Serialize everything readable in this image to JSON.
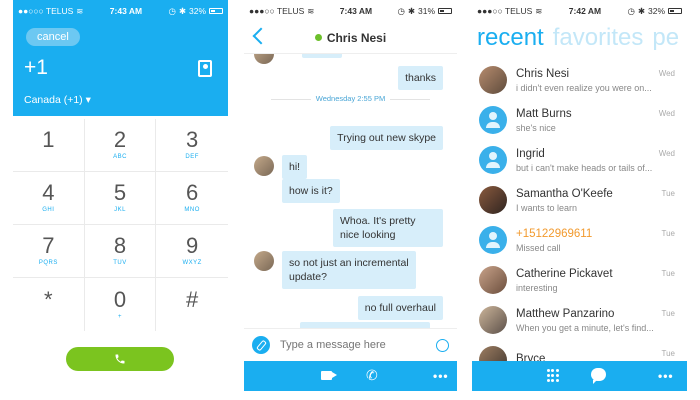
{
  "dialer": {
    "status": {
      "carrier": "●●○○○ TELUS",
      "time": "7:43 AM",
      "battery": "32%"
    },
    "cancel_label": "cancel",
    "number": "+1",
    "country": "Canada (+1) ▾",
    "keys": [
      {
        "digit": "1",
        "letters": ""
      },
      {
        "digit": "2",
        "letters": "ABC"
      },
      {
        "digit": "3",
        "letters": "DEF"
      },
      {
        "digit": "4",
        "letters": "GHI"
      },
      {
        "digit": "5",
        "letters": "JKL"
      },
      {
        "digit": "6",
        "letters": "MNO"
      },
      {
        "digit": "7",
        "letters": "PQRS"
      },
      {
        "digit": "8",
        "letters": "TUV"
      },
      {
        "digit": "9",
        "letters": "WXYZ"
      },
      {
        "digit": "*",
        "letters": ""
      },
      {
        "digit": "0",
        "letters": "+"
      },
      {
        "digit": "#",
        "letters": ""
      }
    ],
    "call_icon": "phone-icon",
    "accent": "#1aaef0",
    "call_color": "#7bc41f"
  },
  "chat": {
    "status": {
      "carrier": "●●●○○ TELUS",
      "time": "7:43 AM",
      "battery": "31%"
    },
    "contact_name": "Chris Nesi",
    "presence_color": "#6cbf2b",
    "date_separator": "Wednesday 2:55 PM",
    "messages": [
      {
        "text": "thanks",
        "side": "out"
      },
      {
        "text": "Trying out new skype",
        "side": "out"
      },
      {
        "text": "hi!",
        "side": "in"
      },
      {
        "text": "how is it?",
        "side": "in"
      },
      {
        "text": "Whoa. It's pretty nice looking",
        "side": "out"
      },
      {
        "text": "so not just an incremental update?",
        "side": "in"
      },
      {
        "text": "no full overhaul",
        "side": "out"
      }
    ],
    "composer_placeholder": "Type a message here",
    "bottom_icons": [
      "video-icon",
      "phone-icon",
      "more-icon"
    ],
    "more_label": "•••",
    "phone_glyph": "✆"
  },
  "recents": {
    "status": {
      "carrier": "●●●○○ TELUS",
      "time": "7:42 AM",
      "battery": "32%"
    },
    "tabs": {
      "recent": "recent",
      "favorites": "favorites",
      "people": "pe"
    },
    "items": [
      {
        "name": "Chris Nesi",
        "snippet": "i didn't even realize you were on...",
        "day": "Wed",
        "avatar": "photo1"
      },
      {
        "name": "Matt Burns",
        "snippet": "she's nice",
        "day": "Wed",
        "avatar": "placeholder"
      },
      {
        "name": "Ingrid",
        "snippet": "but i can't make heads or tails of...",
        "day": "Wed",
        "avatar": "placeholder"
      },
      {
        "name": "Samantha O'Keefe",
        "snippet": "I wants to learn",
        "day": "Tue",
        "avatar": "photo2"
      },
      {
        "name": "+15122969611",
        "snippet": "Missed call",
        "day": "Tue",
        "avatar": "placeholder",
        "missed": true
      },
      {
        "name": "Catherine Pickavet",
        "snippet": "interesting",
        "day": "Tue",
        "avatar": "photo3"
      },
      {
        "name": "Matthew Panzarino",
        "snippet": "When you get a minute, let's find...",
        "day": "Tue",
        "avatar": "photo4"
      },
      {
        "name": "Bryce",
        "snippet": "",
        "day": "Tue",
        "avatar": "photo5"
      }
    ],
    "missed_color": "#f29a2e",
    "bottom_icons": [
      "dialpad-icon",
      "chat-icon",
      "more-icon"
    ],
    "more_label": "•••"
  }
}
